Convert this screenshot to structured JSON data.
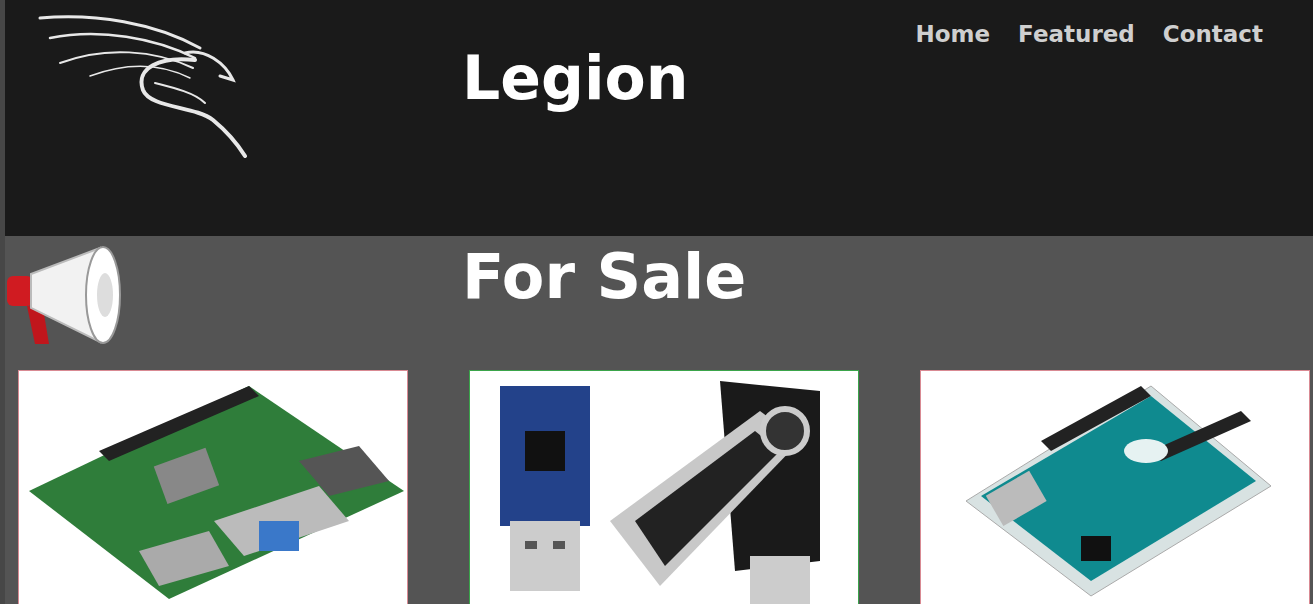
{
  "header": {
    "title": "Legion"
  },
  "nav": [
    {
      "label": "Home"
    },
    {
      "label": "Featured"
    },
    {
      "label": "Contact"
    }
  ],
  "section": {
    "title": "For Sale"
  },
  "products": [
    {
      "kind": "raspberry",
      "color": "#d98a93"
    },
    {
      "kind": "usb",
      "color": "#3aa44a"
    },
    {
      "kind": "arduino",
      "color": "#d98a93"
    }
  ]
}
